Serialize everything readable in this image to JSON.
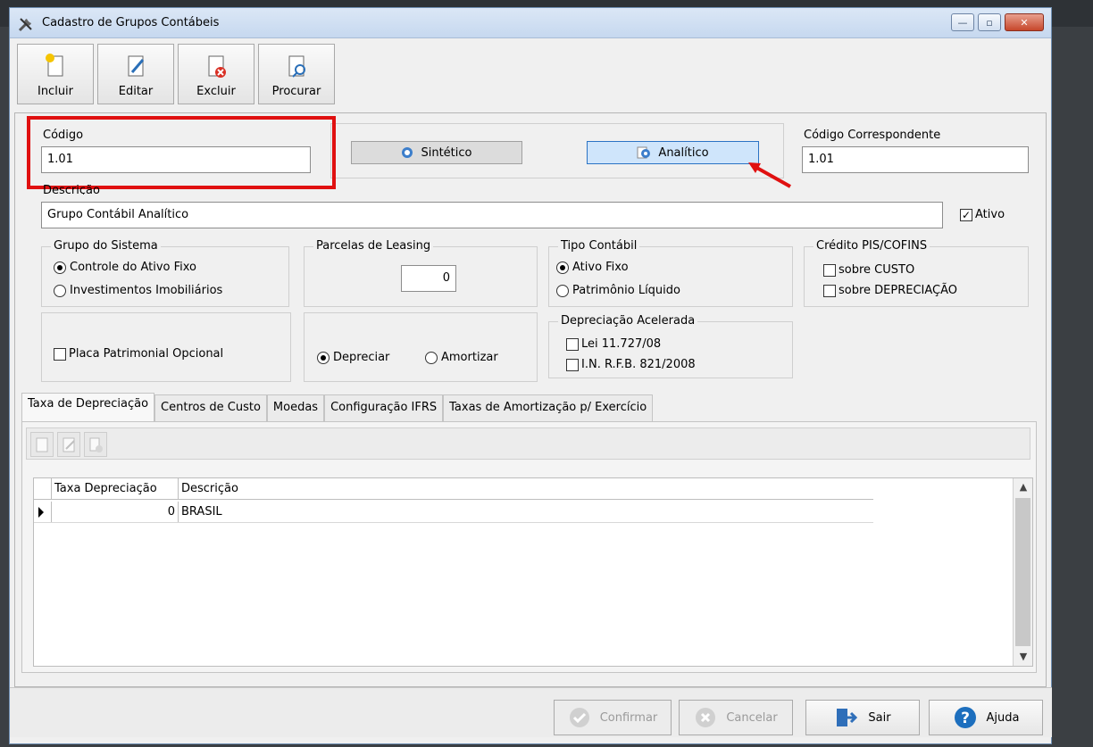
{
  "window": {
    "title": "Cadastro de Grupos Contábeis"
  },
  "toolbar": {
    "incluir": "Incluir",
    "editar": "Editar",
    "excluir": "Excluir",
    "procurar": "Procurar"
  },
  "form": {
    "codigo_label": "Código",
    "codigo_value": "1.01",
    "sintetico_label": "Sintético",
    "analitico_label": "Analítico",
    "codigo_corresp_label": "Código Correspondente",
    "codigo_corresp_value": "1.01",
    "descricao_label": "Descrição",
    "descricao_value": "Grupo Contábil Analítico",
    "ativo_label": "Ativo",
    "ativo_checked": true
  },
  "grupo_sistema": {
    "legend": "Grupo do Sistema",
    "opt1": "Controle do Ativo Fixo",
    "opt2": "Investimentos Imobiliários",
    "selected": "opt1"
  },
  "leasing": {
    "legend": "Parcelas de Leasing",
    "value": "0"
  },
  "tipo_contabil": {
    "legend": "Tipo Contábil",
    "opt1": "Ativo Fixo",
    "opt2": "Patrimônio Líquido",
    "selected": "opt1"
  },
  "credito": {
    "legend": "Crédito PIS/COFINS",
    "opt1": "sobre CUSTO",
    "opt2": "sobre DEPRECIAÇÃO"
  },
  "placa": {
    "label": "Placa Patrimonial Opcional"
  },
  "depreciar": {
    "opt1": "Depreciar",
    "opt2": "Amortizar",
    "selected": "opt1"
  },
  "depreciacao_acelerada": {
    "legend": "Depreciação Acelerada",
    "opt1": "Lei 11.727/08",
    "opt2": "I.N. R.F.B. 821/2008"
  },
  "tabs": [
    "Taxa de Depreciação",
    "Centros de Custo",
    "Moedas",
    "Configuração IFRS",
    "Taxas de Amortização p/ Exercício"
  ],
  "grid": {
    "columns": [
      "Taxa Depreciação",
      "Descrição"
    ],
    "rows": [
      {
        "taxa": "0",
        "descricao": "BRASIL"
      }
    ]
  },
  "footer": {
    "confirmar": "Confirmar",
    "cancelar": "Cancelar",
    "sair": "Sair",
    "ajuda": "Ajuda"
  },
  "colors": {
    "highlight_frame": "#e01010",
    "active_button": "#cfe5fb",
    "help_icon": "#1d6fbe"
  }
}
